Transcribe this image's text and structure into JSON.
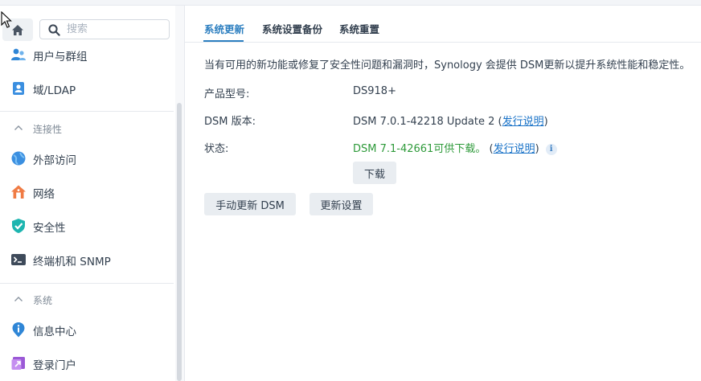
{
  "search": {
    "placeholder": "搜索"
  },
  "sidebar": {
    "items_top": [
      {
        "label": "用户与群组",
        "icon": "users-icon"
      },
      {
        "label": "域/LDAP",
        "icon": "domain-ldap-icon"
      }
    ],
    "sections": [
      {
        "title": "连接性",
        "items": [
          {
            "label": "外部访问",
            "icon": "external-access-icon"
          },
          {
            "label": "网络",
            "icon": "network-icon"
          },
          {
            "label": "安全性",
            "icon": "shield-icon"
          },
          {
            "label": "终端机和 SNMP",
            "icon": "terminal-icon"
          }
        ]
      },
      {
        "title": "系统",
        "items": [
          {
            "label": "信息中心",
            "icon": "info-center-icon"
          },
          {
            "label": "登录门户",
            "icon": "login-portal-icon"
          }
        ]
      }
    ]
  },
  "tabs": [
    "系统更新",
    "系统设置备份",
    "系统重置"
  ],
  "active_tab": "系统更新",
  "main": {
    "description": "当有可用的新功能或修复了安全性问题和漏洞时，Synology 会提供 DSM更新以提升系统性能和稳定性。",
    "model_label": "产品型号:",
    "model_value": "DS918+",
    "version_label": "DSM 版本:",
    "version_value": "DSM 7.0.1-42218 Update 2",
    "release_notes": "发行说明",
    "status_label": "状态:",
    "status_value": "DSM 7.1-42661可供下载。",
    "paren_open": "(",
    "paren_close": ")",
    "download_button": "下载",
    "manual_update_button": "手动更新 DSM",
    "update_settings_button": "更新设置"
  },
  "colors": {
    "accent": "#2d7fc0",
    "status_green": "#2e9a3a",
    "link": "#1a73c8"
  }
}
